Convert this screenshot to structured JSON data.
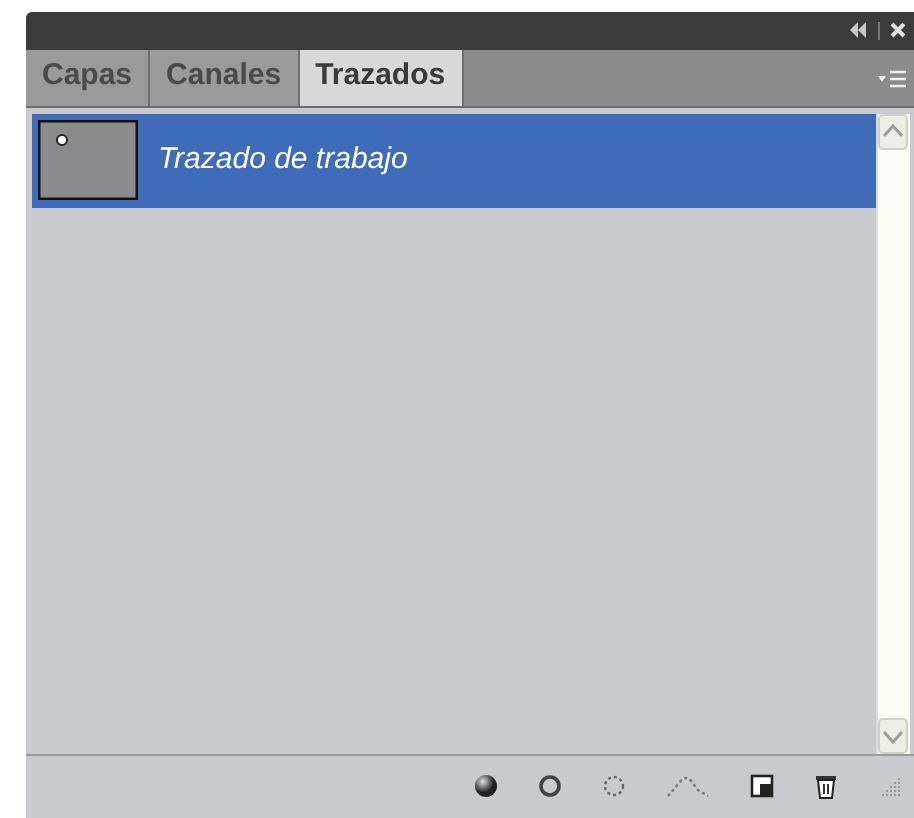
{
  "tabs": [
    {
      "label": "Capas",
      "selected": false
    },
    {
      "label": "Canales",
      "selected": false
    },
    {
      "label": "Trazados",
      "selected": true
    }
  ],
  "paths": [
    {
      "name": "Trazado de trabajo",
      "selected": true
    }
  ]
}
